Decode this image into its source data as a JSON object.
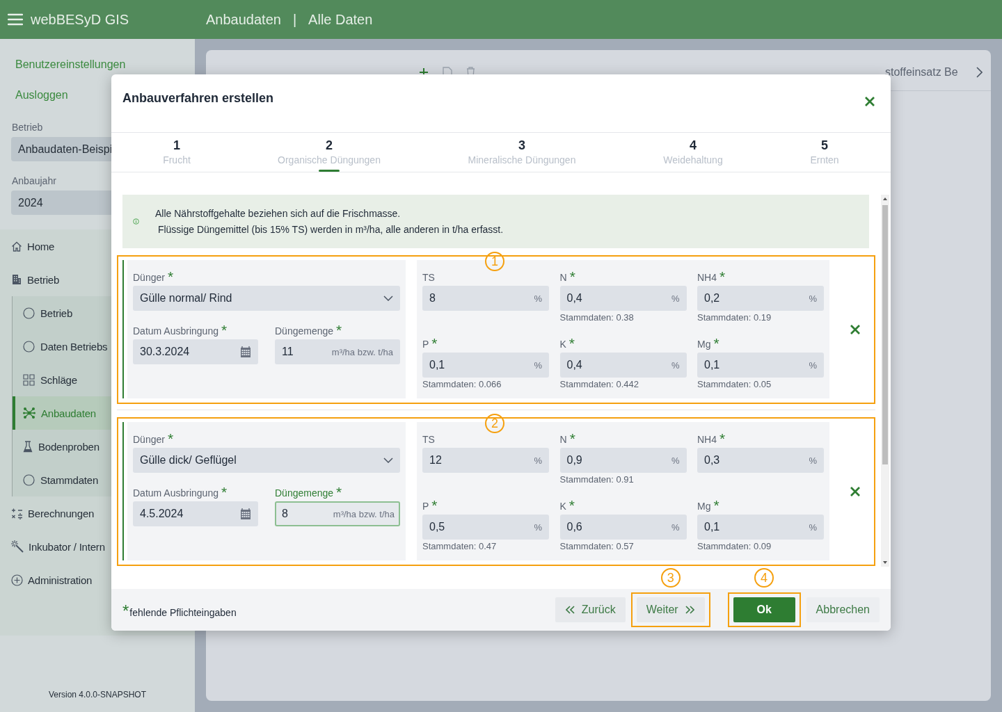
{
  "header": {
    "title": "webBESyD GIS",
    "breadcrumb": [
      "Anbaudaten",
      "Alle Daten"
    ],
    "separator": "|"
  },
  "sidebar": {
    "links": [
      "Benutzereinstellungen",
      "Ausloggen"
    ],
    "selectors": [
      {
        "label": "Betrieb",
        "value": "Anbaudaten-Beispi"
      },
      {
        "label": "Anbaujahr",
        "value": "2024"
      }
    ],
    "nav": [
      {
        "label": "Home",
        "selected": false
      },
      {
        "label": "Betrieb",
        "selected": false,
        "children": [
          {
            "label": "Betrieb",
            "selected": false
          },
          {
            "label": "Daten Betriebs",
            "selected": false
          },
          {
            "label": "Schläge",
            "selected": false
          },
          {
            "label": "Anbaudaten",
            "selected": true
          },
          {
            "label": "Bodenproben",
            "selected": false
          },
          {
            "label": "Stammdaten",
            "selected": false
          }
        ]
      },
      {
        "label": "Berechnungen",
        "selected": false
      },
      {
        "label": "Inkubator / Intern",
        "selected": false
      },
      {
        "label": "Administration",
        "selected": false
      }
    ],
    "version": "Version 4.0.0-SNAPSHOT"
  },
  "card": {
    "tabs": [
      {
        "label": "stoffeinsatz Be",
        "selected": false
      }
    ]
  },
  "dialog": {
    "title": "Anbauverfahren erstellen",
    "steps": [
      {
        "number": "1",
        "label": "Frucht",
        "selected": false
      },
      {
        "number": "2",
        "label": "Organische Düngungen",
        "selected": true
      },
      {
        "number": "3",
        "label": "Mineralische Düngungen",
        "selected": false
      },
      {
        "number": "4",
        "label": "Weidehaltung",
        "selected": false
      },
      {
        "number": "5",
        "label": "Ernten",
        "selected": false
      }
    ],
    "info": [
      "Alle Nährstoffgehalte beziehen sich auf die Frischmasse.",
      " Flüssige Düngemittel (bis 15% TS) werden in m³/ha, alle anderen in t/ha erfasst."
    ],
    "entries": [
      {
        "marker": "1",
        "fertilizer": {
          "label": "Dünger",
          "mark": "*",
          "value": "Gülle normal/ Rind"
        },
        "date": {
          "label": "Datum Ausbringung",
          "mark": "*",
          "value": "30.3.2024"
        },
        "amount": {
          "label": "Düngemenge",
          "mark": "*",
          "value": "11",
          "unit": "m³/ha bzw. t/ha",
          "focused": false
        },
        "nutrients": [
          {
            "label": "TS",
            "value": "8",
            "unit": "%"
          },
          {
            "label": "N",
            "mark": "*",
            "value": "0,4",
            "unit": "%",
            "reference": "Stammdaten: 0.38"
          },
          {
            "label": "NH4",
            "mark": "*",
            "value": "0,2",
            "unit": "%",
            "reference": "Stammdaten: 0.19"
          },
          {
            "label": "P",
            "mark": "*",
            "value": "0,1",
            "unit": "%",
            "reference": "Stammdaten: 0.066"
          },
          {
            "label": "K",
            "mark": "*",
            "value": "0,4",
            "unit": "%",
            "reference": "Stammdaten: 0.442"
          },
          {
            "label": "Mg",
            "mark": "*",
            "value": "0,1",
            "unit": "%",
            "reference": "Stammdaten: 0.05"
          }
        ]
      },
      {
        "marker": "2",
        "fertilizer": {
          "label": "Dünger",
          "mark": "*",
          "value": "Gülle dick/ Geflügel"
        },
        "date": {
          "label": "Datum Ausbringung",
          "mark": "*",
          "value": "4.5.2024"
        },
        "amount": {
          "label": "Düngemenge",
          "mark": "*",
          "value": "8",
          "unit": "m³/ha bzw. t/ha",
          "focused": true
        },
        "nutrients": [
          {
            "label": "TS",
            "value": "12",
            "unit": "%"
          },
          {
            "label": "N",
            "mark": "*",
            "value": "0,9",
            "unit": "%",
            "reference": "Stammdaten: 0.91"
          },
          {
            "label": "NH4",
            "mark": "*",
            "value": "0,3",
            "unit": "%"
          },
          {
            "label": "P",
            "mark": "*",
            "value": "0,5",
            "unit": "%",
            "reference": "Stammdaten: 0.47"
          },
          {
            "label": "K",
            "mark": "*",
            "value": "0,6",
            "unit": "%",
            "reference": "Stammdaten: 0.57"
          },
          {
            "label": "Mg",
            "mark": "*",
            "value": "0,1",
            "unit": "%",
            "reference": "Stammdaten: 0.09"
          }
        ]
      }
    ],
    "footer": {
      "legend": {
        "mark": "*",
        "text": "fehlende Pflichteingaben"
      },
      "buttons": [
        {
          "label": "Zurück",
          "kind": "back"
        },
        {
          "label": "Weiter",
          "kind": "next",
          "marker": "3"
        },
        {
          "label": "Ok",
          "kind": "primary",
          "marker": "4"
        },
        {
          "label": "Abbrechen",
          "kind": "secondary"
        }
      ]
    }
  }
}
